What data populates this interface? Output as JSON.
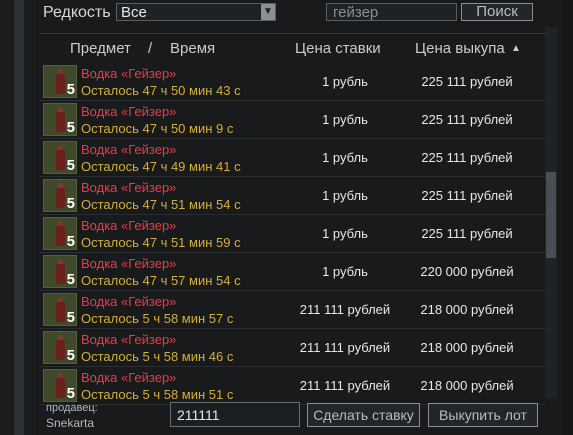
{
  "filters": {
    "rarity_label": "Редкость",
    "rarity_value": "Все",
    "search_value": "гейзер",
    "search_button": "Поиск"
  },
  "table": {
    "header_item": "Предмет",
    "header_sep": "/",
    "header_time": "Время",
    "header_bid": "Цена ставки",
    "header_buyout": "Цена выкупа",
    "sort_indicator": "▲",
    "rows": [
      {
        "qty": "5",
        "name": "Водка «Гейзер»",
        "time": "Осталось 47 ч 50 мин 43 с",
        "bid": "1 рубль",
        "buyout": "225 111 рублей"
      },
      {
        "qty": "5",
        "name": "Водка «Гейзер»",
        "time": "Осталось 47 ч 50 мин 9 с",
        "bid": "1 рубль",
        "buyout": "225 111 рублей"
      },
      {
        "qty": "5",
        "name": "Водка «Гейзер»",
        "time": "Осталось 47 ч 49 мин 41 с",
        "bid": "1 рубль",
        "buyout": "225 111 рублей"
      },
      {
        "qty": "5",
        "name": "Водка «Гейзер»",
        "time": "Осталось 47 ч 51 мин 54 с",
        "bid": "1 рубль",
        "buyout": "225 111 рублей"
      },
      {
        "qty": "5",
        "name": "Водка «Гейзер»",
        "time": "Осталось 47 ч 51 мин 59 с",
        "bid": "1 рубль",
        "buyout": "225 111 рублей"
      },
      {
        "qty": "5",
        "name": "Водка «Гейзер»",
        "time": "Осталось 47 ч 57 мин 54 с",
        "bid": "1 рубль",
        "buyout": "220 000 рублей"
      },
      {
        "qty": "5",
        "name": "Водка «Гейзер»",
        "time": "Осталось 5 ч 58 мин 57 с",
        "bid": "211 111 рублей",
        "buyout": "218 000 рублей"
      },
      {
        "qty": "5",
        "name": "Водка «Гейзер»",
        "time": "Осталось 5 ч 58 мин 46 с",
        "bid": "211 111 рублей",
        "buyout": "218 000 рублей"
      },
      {
        "qty": "5",
        "name": "Водка «Гейзер»",
        "time": "Осталось 5 ч 58 мин 51 с",
        "bid": "211 111 рублей",
        "buyout": "218 000 рублей"
      }
    ]
  },
  "footer": {
    "seller_label": "продавец:",
    "seller_name": "Snekarta",
    "bid_value": "211111",
    "bid_button": "Сделать ставку",
    "buyout_button": "Выкупить лот"
  },
  "colors": {
    "item_name": "#e0404c",
    "time_left": "#d4b03a",
    "background": "#181a1c"
  }
}
